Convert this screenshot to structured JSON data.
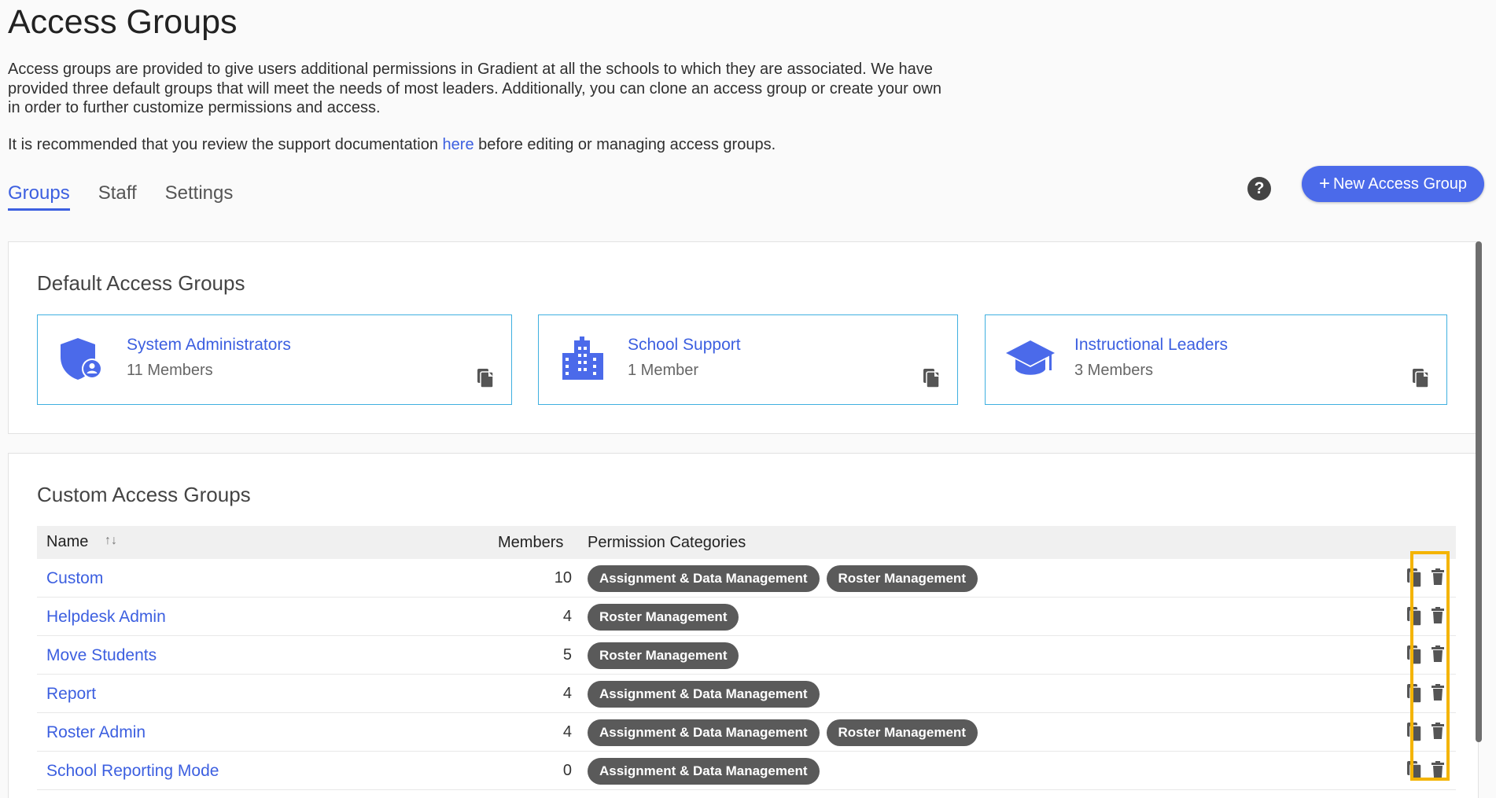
{
  "page": {
    "title": "Access Groups",
    "description": "Access groups are provided to give users additional permissions in Gradient at all the schools to which they are associated. We have provided three default groups that will meet the needs of most leaders. Additionally, you can clone an access group or create your own in order to further customize permissions and access.",
    "recommend_before": "It is recommended that you review the support documentation ",
    "recommend_link": "here",
    "recommend_after": " before editing or managing access groups."
  },
  "tabs": [
    {
      "label": "Groups",
      "active": true
    },
    {
      "label": "Staff",
      "active": false
    },
    {
      "label": "Settings",
      "active": false
    }
  ],
  "toolbar": {
    "help_icon": "?",
    "new_button_plus": "+",
    "new_button_label": "New Access Group"
  },
  "default_groups": {
    "title": "Default Access Groups",
    "cards": [
      {
        "name": "System Administrators",
        "members": "11 Members",
        "icon": "shield-user-icon"
      },
      {
        "name": "School Support",
        "members": "1 Member",
        "icon": "building-icon"
      },
      {
        "name": "Instructional Leaders",
        "members": "3 Members",
        "icon": "graduation-cap-icon"
      }
    ]
  },
  "custom_groups": {
    "title": "Custom Access Groups",
    "columns": {
      "name": "Name",
      "sort": "↑↓",
      "members": "Members",
      "permissions": "Permission Categories"
    },
    "rows": [
      {
        "name": "Custom",
        "members": "10",
        "chips": [
          "Assignment & Data Management",
          "Roster Management"
        ]
      },
      {
        "name": "Helpdesk Admin",
        "members": "4",
        "chips": [
          "Roster Management"
        ]
      },
      {
        "name": "Move Students",
        "members": "5",
        "chips": [
          "Roster Management"
        ]
      },
      {
        "name": "Report",
        "members": "4",
        "chips": [
          "Assignment & Data Management"
        ]
      },
      {
        "name": "Roster Admin",
        "members": "4",
        "chips": [
          "Assignment & Data Management",
          "Roster Management"
        ]
      },
      {
        "name": "School Reporting Mode",
        "members": "0",
        "chips": [
          "Assignment & Data Management"
        ]
      }
    ]
  },
  "colors": {
    "accent": "#4b6aea",
    "link": "#3c5fe0",
    "chip": "#5a5a5a",
    "highlight": "#f4b400",
    "card_border": "#3fb0e0"
  }
}
